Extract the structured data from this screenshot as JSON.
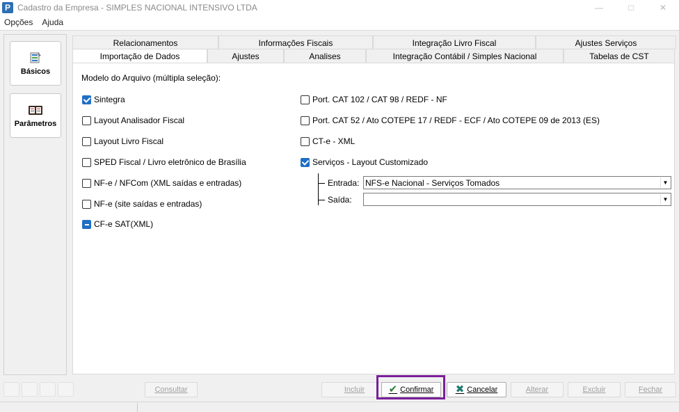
{
  "window": {
    "title": "Cadastro da Empresa - SIMPLES NACIONAL INTENSIVO LTDA",
    "icon_letter": "P",
    "controls": [
      "minimize-icon",
      "maximize-icon",
      "close-icon"
    ]
  },
  "menu": {
    "items": [
      "Opções",
      "Ajuda"
    ]
  },
  "sidebar": {
    "items": [
      {
        "label": "Básicos",
        "icon": "basics-icon"
      },
      {
        "label": "Parâmetros",
        "icon": "parameters-icon"
      }
    ]
  },
  "tabs": {
    "row1": [
      "Relacionamentos",
      "Informações Fiscais",
      "Integração Livro Fiscal",
      "Ajustes Serviços"
    ],
    "row2": [
      "Importação de Dados",
      "Ajustes",
      "Analises",
      "Integração Contábil / Simples Nacional",
      "Tabelas de CST"
    ],
    "active": "Importação de Dados"
  },
  "import": {
    "section_label": "Modelo do Arquivo (múltipla seleção):",
    "left_options": [
      {
        "label": "Sintegra",
        "state": "checked"
      },
      {
        "label": "Layout Analisador Fiscal",
        "state": "unchecked"
      },
      {
        "label": "Layout Livro Fiscal",
        "state": "unchecked"
      },
      {
        "label": "SPED Fiscal / Livro eletrônico de Brasília",
        "state": "unchecked"
      },
      {
        "label": "NF-e / NFCom (XML saídas e entradas)",
        "state": "unchecked"
      },
      {
        "label": "NF-e (site saídas e entradas)",
        "state": "unchecked"
      },
      {
        "label": "CF-e SAT(XML)",
        "state": "indeterminate"
      }
    ],
    "right_options": [
      {
        "label": "Port. CAT 102 / CAT 98 / REDF - NF",
        "state": "unchecked"
      },
      {
        "label": "Port. CAT 52 / Ato COTEPE 17 / REDF - ECF / Ato COTEPE 09 de 2013 (ES)",
        "state": "unchecked"
      },
      {
        "label": "CT-e - XML",
        "state": "unchecked"
      },
      {
        "label": "Serviços - Layout Customizado",
        "state": "checked"
      }
    ],
    "entrada_label": "Entrada:",
    "entrada_value": "NFS-e Nacional - Serviços Tomados",
    "saida_label": "Saída:",
    "saida_value": ""
  },
  "actions": {
    "consultar": "Consultar",
    "incluir": "Incluir",
    "confirmar": "Confirmar",
    "cancelar": "Cancelar",
    "alterar": "Alterar",
    "excluir": "Excluir",
    "fechar": "Fechar"
  },
  "colors": {
    "accent": "#1f6fc5",
    "highlight": "#7a1e9b",
    "confirm_icon": "#2e7d32",
    "cancel_icon": "#1e7a6e"
  }
}
